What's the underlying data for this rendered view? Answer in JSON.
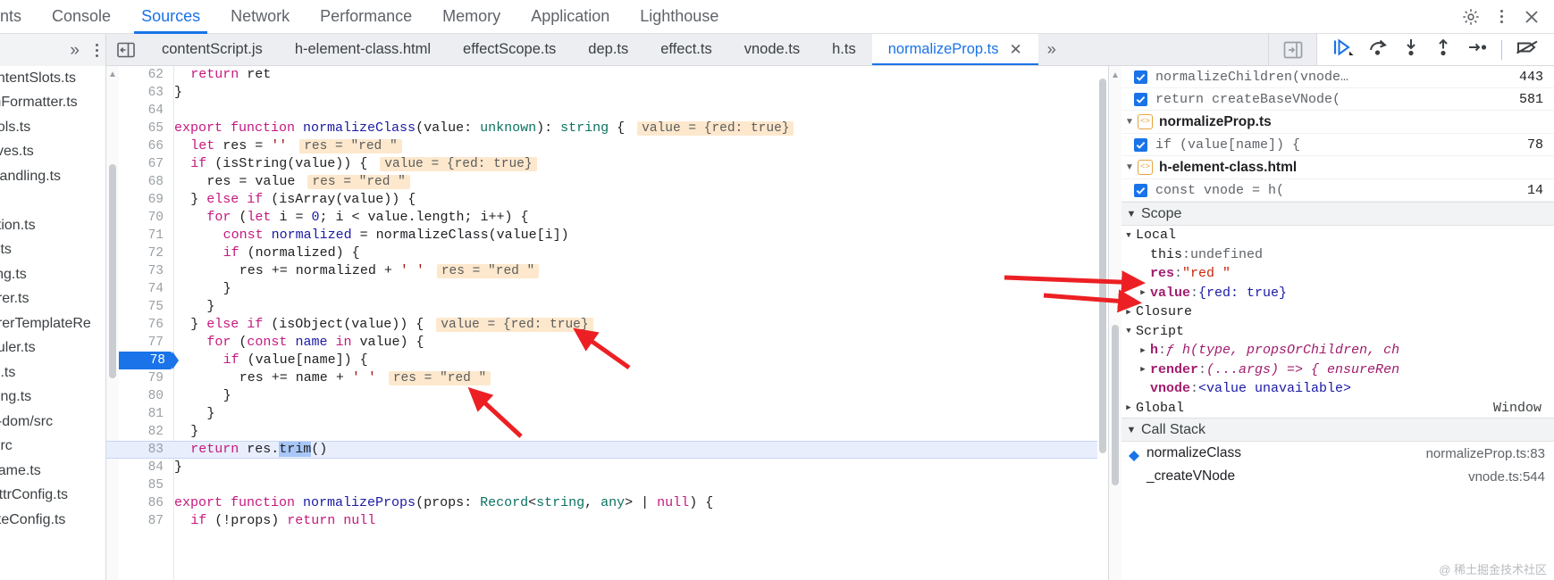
{
  "panel_tabs": [
    {
      "label": "nts",
      "active": false,
      "clipped": true
    },
    {
      "label": "Console",
      "active": false
    },
    {
      "label": "Sources",
      "active": true
    },
    {
      "label": "Network",
      "active": false
    },
    {
      "label": "Performance",
      "active": false
    },
    {
      "label": "Memory",
      "active": false
    },
    {
      "label": "Application",
      "active": false
    },
    {
      "label": "Lighthouse",
      "active": false
    }
  ],
  "panel_toolbar": {
    "settings_icon": "gear-icon",
    "more_icon": "kebab-menu-icon",
    "close_icon": "close-icon"
  },
  "file_tabs": [
    {
      "label": "contentScript.js",
      "active": false
    },
    {
      "label": "h-element-class.html",
      "active": false
    },
    {
      "label": "effectScope.ts",
      "active": false
    },
    {
      "label": "dep.ts",
      "active": false
    },
    {
      "label": "effect.ts",
      "active": false
    },
    {
      "label": "vnode.ts",
      "active": false
    },
    {
      "label": "h.ts",
      "active": false
    },
    {
      "label": "normalizeProp.ts",
      "active": true,
      "closable": true
    }
  ],
  "file_tab_overflow": "»",
  "navigator": {
    "items": [
      "ontentSlots.ts",
      "mFormatter.ts",
      "ools.ts",
      "tives.ts",
      "Handling.ts",
      "ts",
      "ation.ts",
      "x.ts",
      "ling.ts",
      "erer.ts",
      "ererTemplateRe",
      "duler.ts",
      "le.ts",
      "ning.ts",
      "e-dom/src",
      "/src",
      "frame.ts",
      "AttrConfig.ts",
      "ateConfig.ts"
    ]
  },
  "debug_toolbar": [
    {
      "icon": "resume-script-execution-icon",
      "label": "Resume"
    },
    {
      "icon": "step-over-icon",
      "label": "Step over next function call"
    },
    {
      "icon": "step-into-icon",
      "label": "Step into next function call"
    },
    {
      "icon": "step-out-icon",
      "label": "Step out of current function"
    },
    {
      "icon": "step-icon",
      "label": "Step"
    },
    {
      "icon": "deactivate-breakpoints-icon",
      "label": "Deactivate breakpoints"
    }
  ],
  "editor": {
    "execution_line": 83,
    "breakpoint_line": 78,
    "selection": "trim",
    "lines": [
      {
        "n": 62,
        "indent": 2,
        "tokens": [
          {
            "t": "return",
            "c": "kw"
          },
          {
            "t": " ret",
            "c": "pln"
          }
        ]
      },
      {
        "n": 63,
        "indent": 0,
        "tokens": [
          {
            "t": "}",
            "c": "pln"
          }
        ]
      },
      {
        "n": 64,
        "indent": 0,
        "tokens": []
      },
      {
        "n": 65,
        "indent": 0,
        "tokens": [
          {
            "t": "export ",
            "c": "kw"
          },
          {
            "t": "function ",
            "c": "kw"
          },
          {
            "t": "normalizeClass",
            "c": "fn"
          },
          {
            "t": "(value: ",
            "c": "pln"
          },
          {
            "t": "unknown",
            "c": "typ"
          },
          {
            "t": "): ",
            "c": "pln"
          },
          {
            "t": "string",
            "c": "typ"
          },
          {
            "t": " {",
            "c": "pln"
          }
        ],
        "inline": "value = {red: true}"
      },
      {
        "n": 66,
        "indent": 2,
        "tokens": [
          {
            "t": "let",
            "c": "kw"
          },
          {
            "t": " res = ",
            "c": "pln"
          },
          {
            "t": "''",
            "c": "str"
          }
        ],
        "inline": "res = \"red \""
      },
      {
        "n": 67,
        "indent": 2,
        "tokens": [
          {
            "t": "if",
            "c": "kw"
          },
          {
            "t": " (",
            "c": "pln"
          },
          {
            "t": "isString",
            "c": "pln"
          },
          {
            "t": "(value)) {",
            "c": "pln"
          }
        ],
        "inline": "value = {red: true}"
      },
      {
        "n": 68,
        "indent": 4,
        "tokens": [
          {
            "t": "res = value",
            "c": "pln"
          }
        ],
        "inline": "res = \"red \""
      },
      {
        "n": 69,
        "indent": 2,
        "tokens": [
          {
            "t": "} ",
            "c": "pln"
          },
          {
            "t": "else if",
            "c": "kw"
          },
          {
            "t": " (isArray(value)) {",
            "c": "pln"
          }
        ]
      },
      {
        "n": 70,
        "indent": 4,
        "tokens": [
          {
            "t": "for",
            "c": "kw"
          },
          {
            "t": " (",
            "c": "pln"
          },
          {
            "t": "let",
            "c": "kw"
          },
          {
            "t": " i = ",
            "c": "pln"
          },
          {
            "t": "0",
            "c": "num"
          },
          {
            "t": "; i < value.length; i++) {",
            "c": "pln"
          }
        ]
      },
      {
        "n": 71,
        "indent": 6,
        "tokens": [
          {
            "t": "const",
            "c": "kw"
          },
          {
            "t": " ",
            "c": "pln"
          },
          {
            "t": "normalized",
            "c": "fn"
          },
          {
            "t": " = normalizeClass(value[i])",
            "c": "pln"
          }
        ]
      },
      {
        "n": 72,
        "indent": 6,
        "tokens": [
          {
            "t": "if",
            "c": "kw"
          },
          {
            "t": " (normalized) {",
            "c": "pln"
          }
        ]
      },
      {
        "n": 73,
        "indent": 8,
        "tokens": [
          {
            "t": "res += normalized + ",
            "c": "pln"
          },
          {
            "t": "' '",
            "c": "str"
          }
        ],
        "inline": "res = \"red \""
      },
      {
        "n": 74,
        "indent": 6,
        "tokens": [
          {
            "t": "}",
            "c": "pln"
          }
        ]
      },
      {
        "n": 75,
        "indent": 4,
        "tokens": [
          {
            "t": "}",
            "c": "pln"
          }
        ]
      },
      {
        "n": 76,
        "indent": 2,
        "tokens": [
          {
            "t": "} ",
            "c": "pln"
          },
          {
            "t": "else if",
            "c": "kw"
          },
          {
            "t": " (isObject(value)) {",
            "c": "pln"
          }
        ],
        "inline": "value = {red: true}"
      },
      {
        "n": 77,
        "indent": 4,
        "tokens": [
          {
            "t": "for",
            "c": "kw"
          },
          {
            "t": " (",
            "c": "pln"
          },
          {
            "t": "const",
            "c": "kw"
          },
          {
            "t": " ",
            "c": "pln"
          },
          {
            "t": "name",
            "c": "fn"
          },
          {
            "t": " ",
            "c": "pln"
          },
          {
            "t": "in",
            "c": "kw"
          },
          {
            "t": " value) {",
            "c": "pln"
          }
        ]
      },
      {
        "n": 78,
        "indent": 6,
        "tokens": [
          {
            "t": "if",
            "c": "kw"
          },
          {
            "t": " (value[name]) {",
            "c": "pln"
          }
        ]
      },
      {
        "n": 79,
        "indent": 8,
        "tokens": [
          {
            "t": "res += name + ",
            "c": "pln"
          },
          {
            "t": "' '",
            "c": "str"
          }
        ],
        "inline": "res = \"red \""
      },
      {
        "n": 80,
        "indent": 6,
        "tokens": [
          {
            "t": "}",
            "c": "pln"
          }
        ]
      },
      {
        "n": 81,
        "indent": 4,
        "tokens": [
          {
            "t": "}",
            "c": "pln"
          }
        ]
      },
      {
        "n": 82,
        "indent": 2,
        "tokens": [
          {
            "t": "}",
            "c": "pln"
          }
        ]
      },
      {
        "n": 83,
        "indent": 2,
        "tokens": [
          {
            "t": "return",
            "c": "kw"
          },
          {
            "t": " res.",
            "c": "pln"
          },
          {
            "t": "trim",
            "c": "sel"
          },
          {
            "t": "()",
            "c": "pln"
          }
        ]
      },
      {
        "n": 84,
        "indent": 0,
        "tokens": [
          {
            "t": "}",
            "c": "pln"
          }
        ]
      },
      {
        "n": 85,
        "indent": 0,
        "tokens": []
      },
      {
        "n": 86,
        "indent": 0,
        "tokens": [
          {
            "t": "export ",
            "c": "kw"
          },
          {
            "t": "function ",
            "c": "kw"
          },
          {
            "t": "normalizeProps",
            "c": "fn"
          },
          {
            "t": "(props: ",
            "c": "pln"
          },
          {
            "t": "Record",
            "c": "typ"
          },
          {
            "t": "<",
            "c": "pln"
          },
          {
            "t": "string",
            "c": "typ"
          },
          {
            "t": ", ",
            "c": "pln"
          },
          {
            "t": "any",
            "c": "typ"
          },
          {
            "t": "> | ",
            "c": "pln"
          },
          {
            "t": "null",
            "c": "kw"
          },
          {
            "t": ") {",
            "c": "pln"
          }
        ]
      },
      {
        "n": 87,
        "indent": 2,
        "tokens": [
          {
            "t": "if",
            "c": "kw"
          },
          {
            "t": " (!props) ",
            "c": "pln"
          },
          {
            "t": "return",
            "c": "kw"
          },
          {
            "t": " ",
            "c": "pln"
          },
          {
            "t": "null",
            "c": "kw"
          }
        ]
      }
    ]
  },
  "sidebar": {
    "breakpoints": [
      {
        "kind": "bp",
        "checked": true,
        "text": "normalizeChildren(vnode…",
        "line": "443"
      },
      {
        "kind": "bp",
        "checked": true,
        "text": "return createBaseVNode(",
        "line": "581"
      },
      {
        "kind": "file",
        "name": "normalizeProp.ts",
        "expanded": true,
        "icon": "source-file-icon"
      },
      {
        "kind": "bp",
        "checked": true,
        "text": "if (value[name]) {",
        "line": "78"
      },
      {
        "kind": "file",
        "name": "h-element-class.html",
        "expanded": true,
        "icon": "source-file-icon"
      },
      {
        "kind": "bp",
        "checked": true,
        "text": "const vnode = h(",
        "line": "14"
      }
    ],
    "scope_header": "Scope",
    "scope": [
      {
        "tri": "down",
        "indent": 0,
        "name": "Local",
        "bold": false
      },
      {
        "tri": "none",
        "indent": 1,
        "name": "this",
        "sep": ": ",
        "value": "undefined",
        "vclass": "plain"
      },
      {
        "tri": "none",
        "indent": 1,
        "name": "res",
        "sep": ": ",
        "value": "\"red \"",
        "vclass": "str",
        "prop": true
      },
      {
        "tri": "right",
        "indent": 1,
        "name": "value",
        "sep": ": ",
        "value": "{red: true}",
        "vclass": "obj",
        "prop": true
      },
      {
        "tri": "right",
        "indent": 0,
        "name": "Closure"
      },
      {
        "tri": "down",
        "indent": 0,
        "name": "Script"
      },
      {
        "tri": "right",
        "indent": 1,
        "name": "h",
        "sep": ": ",
        "value": "ƒ h(type, propsOrChildren, ch",
        "vclass": "fnv",
        "prop": true
      },
      {
        "tri": "right",
        "indent": 1,
        "name": "render",
        "sep": ": ",
        "value": "(...args) => { ensureRen",
        "vclass": "fnv",
        "prop": true
      },
      {
        "tri": "none",
        "indent": 1,
        "name": "vnode",
        "sep": ": ",
        "value": "<value unavailable>",
        "vclass": "unavail",
        "prop": true
      },
      {
        "tri": "right",
        "indent": 0,
        "name": "Global",
        "right": "Window"
      }
    ],
    "callstack_header": "Call Stack",
    "call_stack": [
      {
        "name": "normalizeClass",
        "location": "normalizeProp.ts:83",
        "selected": true
      },
      {
        "name": "_createVNode",
        "location": "vnode.ts:544",
        "selected": false
      }
    ]
  },
  "watermark": "@ 稀土掘金技术社区"
}
